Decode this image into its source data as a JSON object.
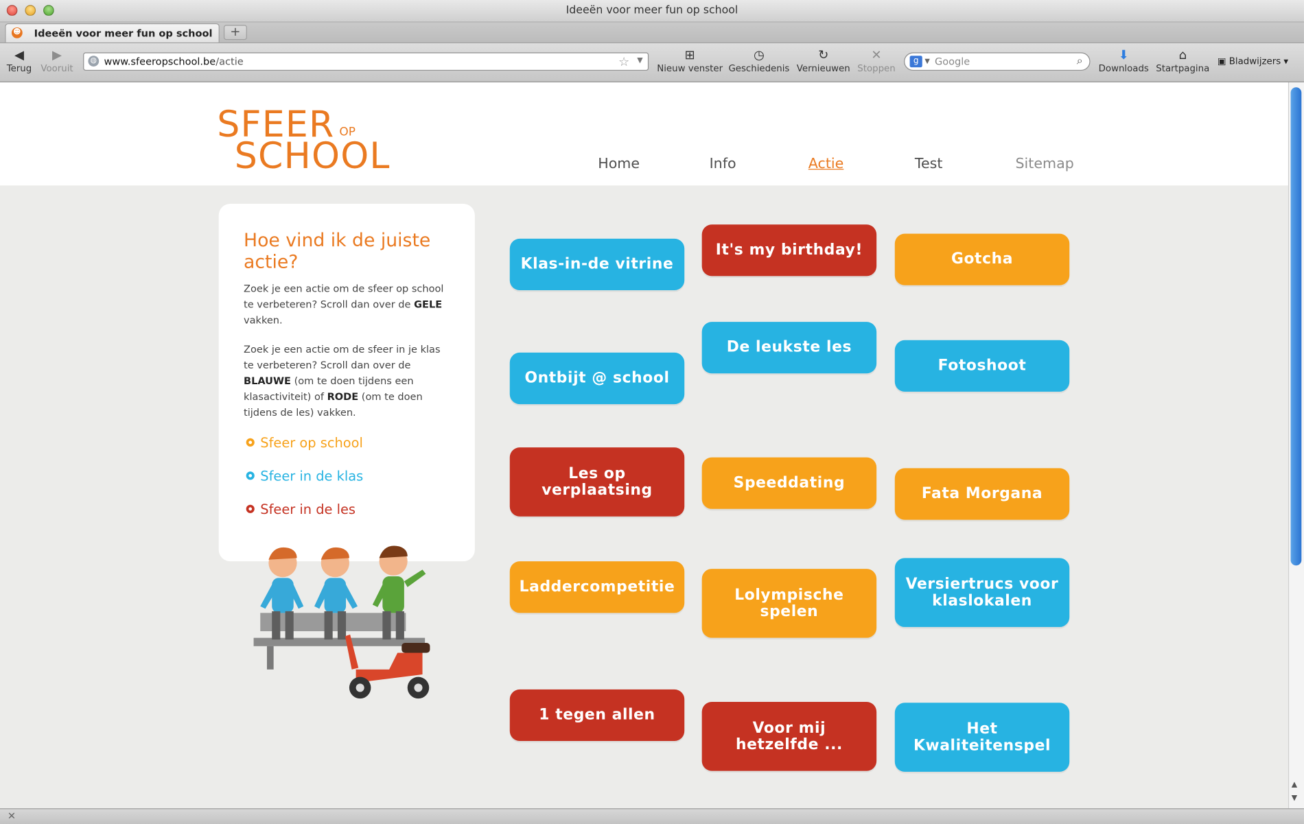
{
  "window": {
    "title": "Ideeën voor meer fun op school"
  },
  "tab": {
    "label": "Ideeën voor meer fun op school",
    "new_tab": "+"
  },
  "toolbar": {
    "back": "Terug",
    "forward": "Vooruit",
    "url_host": "www.sfeeropschool.be",
    "url_path": "/actie",
    "new_window": "Nieuw venster",
    "history": "Geschiedenis",
    "reload": "Vernieuwen",
    "stop": "Stoppen",
    "search_placeholder": "Google",
    "downloads": "Downloads",
    "home": "Startpagina",
    "bookmarks": "Bladwijzers"
  },
  "logo": {
    "line1": "SFEER",
    "op": "OP",
    "line2": "SCHOOL"
  },
  "nav": [
    "Home",
    "Info",
    "Actie",
    "Test",
    "Sitemap"
  ],
  "sidebar": {
    "title": "Hoe vind ik de juiste actie?",
    "p1_a": "Zoek je een actie om de sfeer op school te verbeteren? Scroll dan over de ",
    "p1_b": "GELE",
    "p1_c": " vakken.",
    "p2_a": "Zoek je een actie om de sfeer in je klas te verbeteren? Scroll dan over de ",
    "p2_b": "BLAUWE",
    "p2_c": " (om te doen tijdens een klasactiviteit) of ",
    "p2_d": "RODE",
    "p2_e": " (om te doen tijdens de les) vakken.",
    "legend": [
      "Sfeer op school",
      "Sfeer in de klas",
      "Sfeer in de les"
    ]
  },
  "colors": {
    "orange": "#f7a21b",
    "blue": "#27b3e2",
    "red": "#c53222",
    "brand": "#ea7a21"
  },
  "tiles": [
    {
      "label": "Klas-in-de vitrine",
      "color": "blue"
    },
    {
      "label": "It's my birthday!",
      "color": "red"
    },
    {
      "label": "Gotcha",
      "color": "orange"
    },
    {
      "label": "De leukste les",
      "color": "blue"
    },
    {
      "label": "Ontbijt @ school",
      "color": "blue"
    },
    {
      "label": "Fotoshoot",
      "color": "blue"
    },
    {
      "label": "Les op\nverplaatsing",
      "color": "red"
    },
    {
      "label": "Speeddating",
      "color": "orange"
    },
    {
      "label": "Fata Morgana",
      "color": "orange"
    },
    {
      "label": "Laddercompetitie",
      "color": "orange"
    },
    {
      "label": "Lolympische\nspelen",
      "color": "orange"
    },
    {
      "label": "Versiertrucs voor\nklaslokalen",
      "color": "blue"
    },
    {
      "label": "1 tegen allen",
      "color": "red"
    },
    {
      "label": "Voor mij\nhetzelfde ...",
      "color": "red"
    },
    {
      "label": "Het\nKwaliteitenspel",
      "color": "blue"
    }
  ]
}
